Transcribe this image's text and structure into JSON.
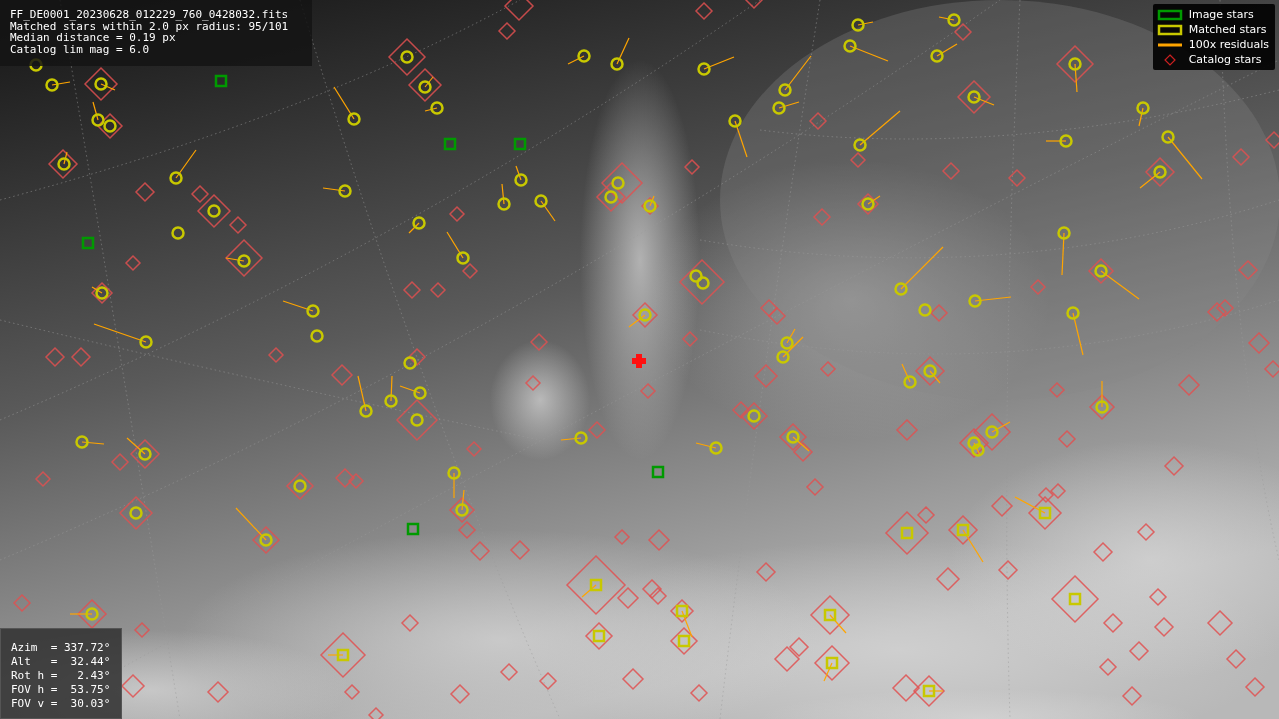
{
  "file_info": {
    "lines": [
      "FF_DE0001_20230628_012229_760_0428032.fits",
      "Matched stars within 2.0 px radius: 95/101",
      "Median distance = 0.19 px",
      "Catalog lim mag = 6.0"
    ]
  },
  "legend": [
    {
      "kind": "box",
      "color": "#009a00",
      "label": "Image stars"
    },
    {
      "kind": "box",
      "color": "#c8c800",
      "label": "Matched stars"
    },
    {
      "kind": "line",
      "color": "#ffa500",
      "label": "100x residuals"
    },
    {
      "kind": "diamond",
      "color": "#cc2020",
      "label": "Catalog stars"
    }
  ],
  "pointing": {
    "lines": [
      "Azim  = 337.72°",
      "Alt   =  32.44°",
      "Rot h =   2.43°",
      "FOV h =  53.75°",
      "FOV v =  30.03°"
    ]
  }
}
